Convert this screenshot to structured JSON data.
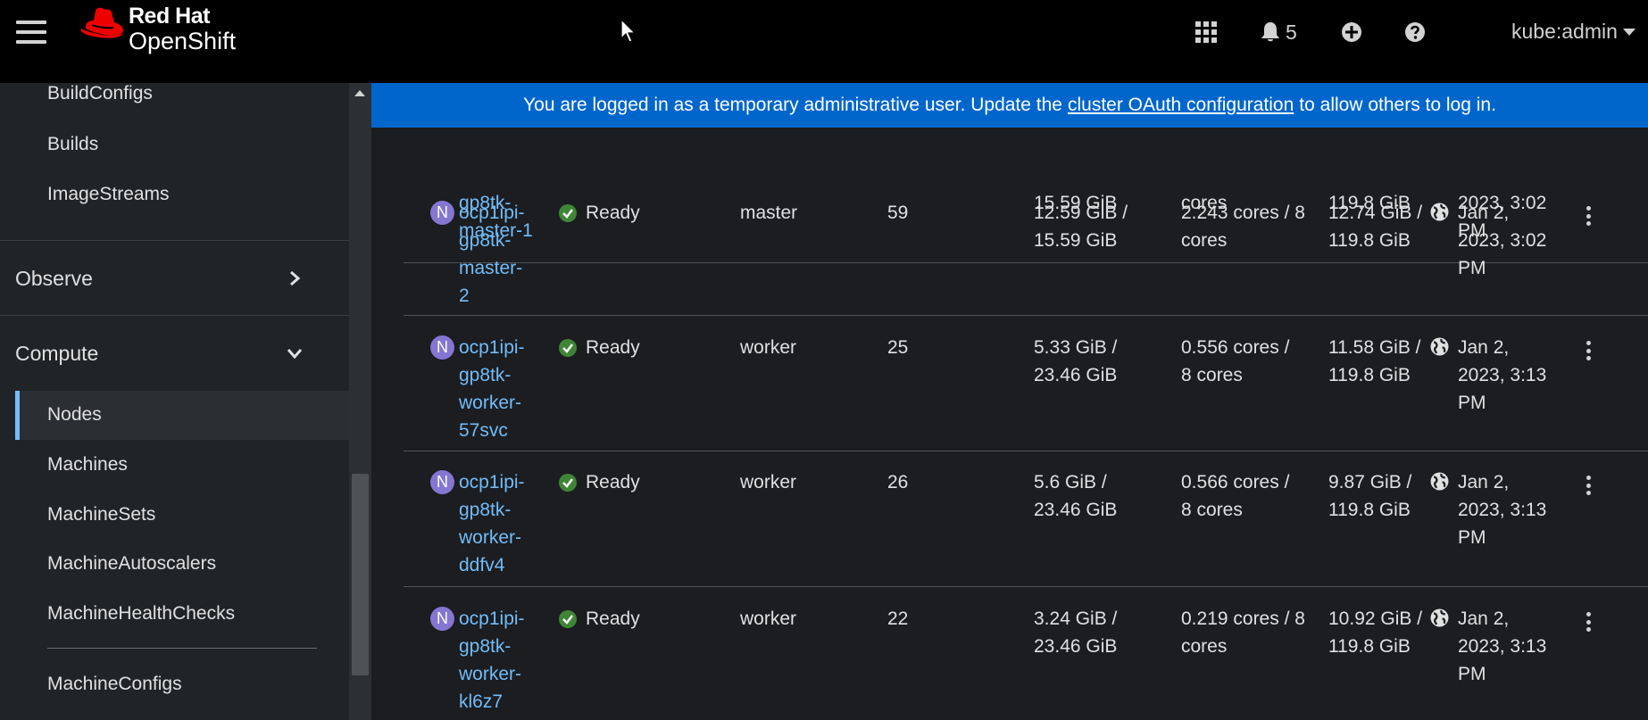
{
  "masthead": {
    "brand_line1": "Red Hat",
    "brand_line2": "OpenShift",
    "notification_count": "5",
    "user": "kube:admin",
    "icons": [
      "menu-icon",
      "app-launcher-icon",
      "bell-icon",
      "plus-circle-icon",
      "help-icon"
    ]
  },
  "banner": {
    "text_before": "You are logged in as a temporary administrative user. Update the",
    "link": "cluster OAuth configuration",
    "text_after": "to allow others to log in."
  },
  "sidebar": {
    "build_items": [
      "BuildConfigs",
      "Builds",
      "ImageStreams"
    ],
    "observe": "Observe",
    "compute": "Compute",
    "compute_items": [
      "Nodes",
      "Machines",
      "MachineSets",
      "MachineAutoscalers",
      "MachineHealthChecks"
    ],
    "machine_configs": "MachineConfigs",
    "active": "Nodes"
  },
  "table": {
    "partial_row": {
      "name_tail": [
        "gp8tk-",
        "master-1"
      ],
      "memory_tail": "15.59 GiB",
      "cpu_tail": "cores",
      "fs_tail": "119.8 GiB",
      "created_tail": [
        "2023, 3:02",
        "PM"
      ]
    },
    "rows": [
      {
        "badge": "N",
        "name": [
          "ocp1ipi-",
          "gp8tk-",
          "master-",
          "2"
        ],
        "status": "Ready",
        "role": "master",
        "pods": "59",
        "memory": [
          "12.59 GiB /",
          "15.59 GiB"
        ],
        "cpu": [
          "2.243 cores / 8",
          "cores"
        ],
        "filesystem": [
          "12.74 GiB /",
          "119.8 GiB"
        ],
        "created": [
          "Jan 2,",
          "2023, 3:02",
          "PM"
        ]
      },
      {
        "badge": "N",
        "name": [
          "ocp1ipi-",
          "gp8tk-",
          "worker-",
          "57svc"
        ],
        "status": "Ready",
        "role": "worker",
        "pods": "25",
        "memory": [
          "5.33 GiB /",
          "23.46 GiB"
        ],
        "cpu": [
          "0.556 cores /",
          "8 cores"
        ],
        "filesystem": [
          "11.58 GiB /",
          "119.8 GiB"
        ],
        "created": [
          "Jan 2,",
          "2023, 3:13",
          "PM"
        ]
      },
      {
        "badge": "N",
        "name": [
          "ocp1ipi-",
          "gp8tk-",
          "worker-",
          "ddfv4"
        ],
        "status": "Ready",
        "role": "worker",
        "pods": "26",
        "memory": [
          "5.6 GiB /",
          "23.46 GiB"
        ],
        "cpu": [
          "0.566 cores /",
          "8 cores"
        ],
        "filesystem": [
          "9.87 GiB /",
          "119.8 GiB"
        ],
        "created": [
          "Jan 2,",
          "2023, 3:13",
          "PM"
        ]
      },
      {
        "badge": "N",
        "name": [
          "ocp1ipi-",
          "gp8tk-",
          "worker-",
          "kl6z7"
        ],
        "status": "Ready",
        "role": "worker",
        "pods": "22",
        "memory": [
          "3.24 GiB /",
          "23.46 GiB"
        ],
        "cpu": [
          "0.219 cores / 8",
          "cores"
        ],
        "filesystem": [
          "10.92 GiB /",
          "119.8 GiB"
        ],
        "created": [
          "Jan 2,",
          "2023, 3:13",
          "PM"
        ]
      }
    ]
  },
  "colors": {
    "masthead": "#000000",
    "banner": "#0066cc",
    "link": "#73bcf7",
    "badge": "#8476d1",
    "ready": "#3e8635",
    "active_indicator": "#73bcf7"
  }
}
